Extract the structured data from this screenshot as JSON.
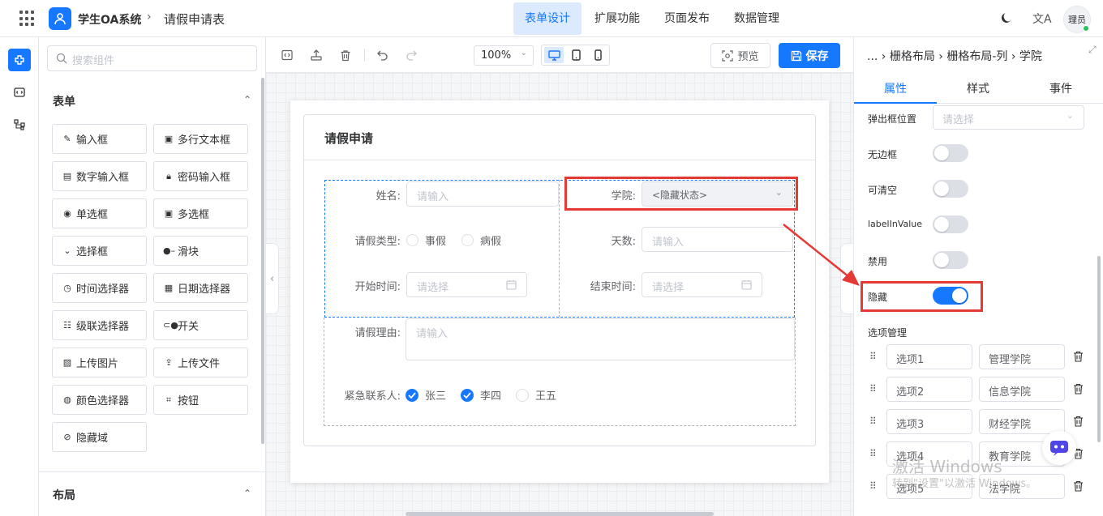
{
  "header": {
    "app_title": "学生OA系统",
    "breadcrumb_sep": "›",
    "page_name": "请假申请表",
    "tabs": [
      {
        "label": "表单设计",
        "active": true
      },
      {
        "label": "扩展功能",
        "active": false
      },
      {
        "label": "页面发布",
        "active": false
      },
      {
        "label": "数据管理",
        "active": false
      }
    ],
    "lang_glyph": "文A",
    "avatar_text": "理员"
  },
  "components": {
    "search_placeholder": "搜索组件",
    "section_form": "表单",
    "section_layout": "布局",
    "items": [
      {
        "label": "输入框",
        "icon": "pencil-icon"
      },
      {
        "label": "多行文本框",
        "icon": "textarea-icon"
      },
      {
        "label": "数字输入框",
        "icon": "number-icon"
      },
      {
        "label": "密码输入框",
        "icon": "lock-icon"
      },
      {
        "label": "单选框",
        "icon": "radio-icon"
      },
      {
        "label": "多选框",
        "icon": "checkbox-icon"
      },
      {
        "label": "选择框",
        "icon": "select-icon"
      },
      {
        "label": "滑块",
        "icon": "slider-icon"
      },
      {
        "label": "时间选择器",
        "icon": "clock-icon"
      },
      {
        "label": "日期选择器",
        "icon": "calendar-icon"
      },
      {
        "label": "级联选择器",
        "icon": "cascader-icon"
      },
      {
        "label": "开关",
        "icon": "switch-icon"
      },
      {
        "label": "上传图片",
        "icon": "image-icon"
      },
      {
        "label": "上传文件",
        "icon": "upload-icon"
      },
      {
        "label": "颜色选择器",
        "icon": "palette-icon"
      },
      {
        "label": "按钮",
        "icon": "button-icon"
      },
      {
        "label": "隐藏域",
        "icon": "eye-off-icon"
      }
    ]
  },
  "toolbar": {
    "zoom": "100%",
    "preview_label": "预览",
    "save_label": "保存"
  },
  "form": {
    "title": "请假申请",
    "name_label": "姓名:",
    "name_placeholder": "请输入",
    "college_label": "学院:",
    "college_value": "<隐藏状态>",
    "leave_type_label": "请假类型:",
    "leave_options": [
      "事假",
      "病假"
    ],
    "days_label": "天数:",
    "days_placeholder": "请输入",
    "start_label": "开始时间:",
    "start_placeholder": "请选择",
    "end_label": "结束时间:",
    "end_placeholder": "请选择",
    "reason_label": "请假理由:",
    "reason_placeholder": "请输入",
    "contact_label": "紧急联系人:",
    "contacts": [
      {
        "name": "张三",
        "checked": true
      },
      {
        "name": "李四",
        "checked": true
      },
      {
        "name": "王五",
        "checked": false
      }
    ]
  },
  "props": {
    "breadcrumb": "... › 栅格布局 › 栅格布局-列 › 学院",
    "tabs": [
      "属性",
      "样式",
      "事件"
    ],
    "popup_position_label": "弹出框位置",
    "popup_position_placeholder": "请选择",
    "switches": [
      {
        "label": "无边框",
        "on": false
      },
      {
        "label": "可清空",
        "on": false
      },
      {
        "label": "labelInValue",
        "on": false
      },
      {
        "label": "禁用",
        "on": false
      },
      {
        "label": "隐藏",
        "on": true
      }
    ],
    "options_title": "选项管理",
    "options": [
      {
        "key": "选项1",
        "value": "管理学院"
      },
      {
        "key": "选项2",
        "value": "信息学院"
      },
      {
        "key": "选项3",
        "value": "财经学院"
      },
      {
        "key": "选项4",
        "value": "教育学院"
      },
      {
        "key": "选项5",
        "value": "法学院"
      }
    ]
  },
  "watermark": {
    "line1": "激活 Windows",
    "line2": "转到\"设置\"以激活 Windows。"
  },
  "colors": {
    "accent": "#1677ff",
    "highlight": "#e53935"
  }
}
